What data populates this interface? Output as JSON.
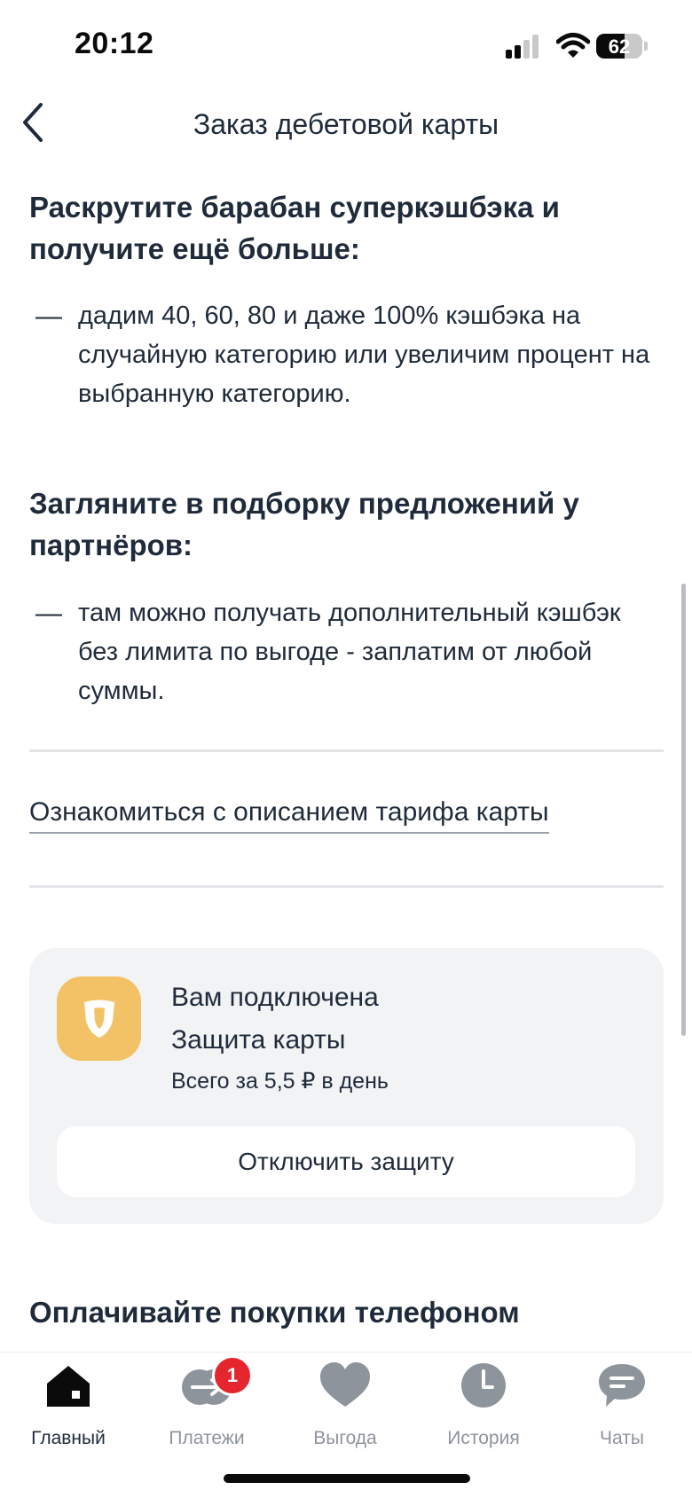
{
  "status_bar": {
    "time": "20:12",
    "battery_percent": "62",
    "battery_level": 0.62
  },
  "header": {
    "title": "Заказ дебетовой карты"
  },
  "sections": [
    {
      "heading": "Раскрутите барабан суперкэшбэка и получите ещё больше:",
      "bullet_marker": "—",
      "bullet": "дадим 40, 60, 80 и даже 100% кэшбэка на случайную категорию или увеличим процент на выбранную категорию."
    },
    {
      "heading": "Загляните в подборку предложений у партнёров:",
      "bullet_marker": "—",
      "bullet": "там можно получать дополнительный кэшбэк без лимита по выгоде - заплатим от любой суммы."
    }
  ],
  "tariff_link": "Ознакомиться с описанием тарифа карты",
  "protection_card": {
    "line1": "Вам подключена",
    "line2": "Защита карты",
    "price": "Всего за 5,5 ₽ в день",
    "button": "Отключить защиту",
    "icon": "shield-icon",
    "tile_color": "#f3c267"
  },
  "next_heading": "Оплачивайте покупки телефоном",
  "tabs": [
    {
      "label": "Главный",
      "icon": "home-icon",
      "active": true
    },
    {
      "label": "Платежи",
      "icon": "transfer-icon",
      "badge": "1"
    },
    {
      "label": "Выгода",
      "icon": "heart-icon"
    },
    {
      "label": "История",
      "icon": "clock-icon"
    },
    {
      "label": "Чаты",
      "icon": "chat-icon"
    }
  ],
  "colors": {
    "text": "#1f2b3a",
    "badge": "#e5262e",
    "card_bg": "#f2f3f5",
    "inactive_tab": "#8e949c"
  }
}
